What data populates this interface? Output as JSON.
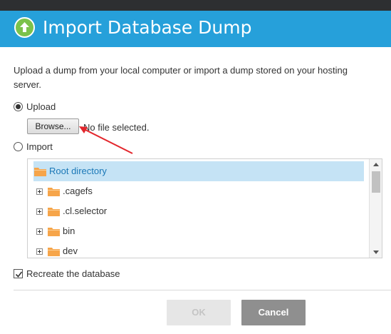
{
  "dialog": {
    "title": "Import Database Dump",
    "header_icon": "upload-arrow-icon",
    "intro_text": "Upload a dump from your local computer or import a dump stored on your hosting server."
  },
  "upload_option": {
    "label": "Upload",
    "selected": true,
    "browse_label": "Browse...",
    "file_status": "No file selected."
  },
  "import_option": {
    "label": "Import",
    "selected": false
  },
  "file_tree": {
    "root": {
      "label": "Root directory",
      "icon": "folder-icon",
      "selected": true
    },
    "items": [
      {
        "label": ".cagefs",
        "icon": "folder-icon",
        "expander": "plus"
      },
      {
        "label": ".cl.selector",
        "icon": "folder-icon",
        "expander": "plus"
      },
      {
        "label": "bin",
        "icon": "folder-icon",
        "expander": "plus"
      },
      {
        "label": "dev",
        "icon": "folder-icon",
        "expander": "plus"
      }
    ]
  },
  "recreate_database": {
    "label": "Recreate the database",
    "checked": true
  },
  "buttons": {
    "ok_label": "OK",
    "ok_enabled": false,
    "cancel_label": "Cancel"
  },
  "colors": {
    "header": "#26a0da",
    "upload_icon": "#7bc24b",
    "folder": "#f6a54a",
    "selection": "#c5e3f5",
    "annotation_arrow": "#e3262c"
  }
}
